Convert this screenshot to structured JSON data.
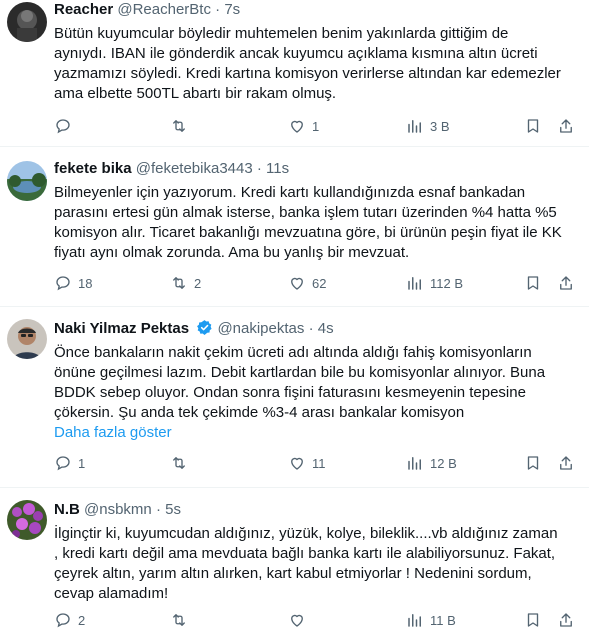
{
  "tweets": [
    {
      "name": "Reacher",
      "handle": "@ReacherBtc",
      "time": "7s",
      "verified": false,
      "text": "Bütün kuyumcular böyledir muhtemelen benim yakınlarda gittiğim de\naynıydı. IBAN ile gönderdik ancak kuyumcu açıklama kısmına altın ücreti\nyazmamızı söyledi. Kredi kartına komisyon verirlerse altından kar edemezler\nama elbette 500TL abartı bir rakam olmuş.",
      "show_more": "",
      "replies": "",
      "retweets": "",
      "likes": "1",
      "views": "3 B"
    },
    {
      "name": "fekete bika",
      "handle": "@feketebika3443",
      "time": "11s",
      "verified": false,
      "text": "Bilmeyenler için yazıyorum. Kredi kartı kullandığınızda esnaf bankadan\nparasını ertesi gün almak isterse, banka işlem tutarı üzerinden %4 hatta %5\nkomisyon alır. Ticaret bakanlığı mevzuatına göre, bi ürünün peşin fiyat ile KK\nfiyatı aynı olmak zorunda. Ama bu yanlış bir mevzuat.",
      "show_more": "",
      "replies": "18",
      "retweets": "2",
      "likes": "62",
      "views": "112 B"
    },
    {
      "name": "Naki Yilmaz Pektas",
      "handle": "@nakipektas",
      "time": "4s",
      "verified": true,
      "text": "Önce bankaların nakit çekim ücreti adı altında aldığı fahiş komisyonların\nönüne geçilmesi lazım. Debit kartlardan bile bu komisyonlar alınıyor. Buna\nBDDK sebep oluyor. Ondan sonra fişini faturasını kesmeyenin tepesine\nçökersin. Şu anda tek çekimde %3-4 arası bankalar komisyon",
      "show_more": "Daha fazla göster",
      "replies": "1",
      "retweets": "",
      "likes": "11",
      "views": "12 B"
    },
    {
      "name": "N.B",
      "handle": "@nsbkmn",
      "time": "5s",
      "verified": false,
      "text": "İlginçtir ki, kuyumcudan aldığınız, yüzük, kolye, bileklik....vb aldığınız zaman\n, kredi kartı değil ama mevduata bağlı banka kartı ile alabiliyorsunuz. Fakat,\nçeyrek altın, yarım altın alırken, kart kabul etmiyorlar ! Nedenini sordum,\ncevap alamadım!",
      "show_more": "",
      "replies": "2",
      "retweets": "",
      "likes": "",
      "views": "11 B"
    }
  ],
  "ui": {
    "dot": "·",
    "more_menu": "···"
  },
  "colors": {
    "accent": "#1d9bf0",
    "muted": "#536471",
    "text": "#0f1419",
    "divider": "#eff3f4"
  },
  "icons": [
    "reply-icon",
    "retweet-icon",
    "like-icon",
    "views-icon",
    "bookmark-icon",
    "share-icon",
    "verified-badge-icon",
    "more-icon"
  ]
}
